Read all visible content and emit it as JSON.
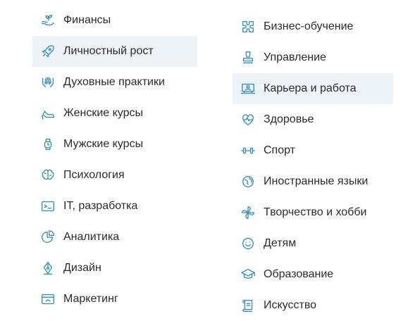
{
  "theme": {
    "icon_color": "#3a8fb7",
    "active_bg": "#eef3f8",
    "text_color": "#2b2b2b"
  },
  "left_column": [
    {
      "label": "Финансы",
      "icon": "hand-plant-icon",
      "active": false
    },
    {
      "label": "Личностный рост",
      "icon": "rocket-icon",
      "active": true
    },
    {
      "label": "Духовные практики",
      "icon": "hands-spiral-icon",
      "active": false
    },
    {
      "label": "Женские курсы",
      "icon": "high-heel-icon",
      "active": false
    },
    {
      "label": "Мужские курсы",
      "icon": "watch-icon",
      "active": false
    },
    {
      "label": "Психология",
      "icon": "brain-icon",
      "active": false
    },
    {
      "label": "IT, разработка",
      "icon": "terminal-icon",
      "active": false
    },
    {
      "label": "Аналитика",
      "icon": "pie-chart-icon",
      "active": false
    },
    {
      "label": "Дизайн",
      "icon": "pen-nib-icon",
      "active": false
    },
    {
      "label": "Маркетинг",
      "icon": "browser-window-icon",
      "active": false
    }
  ],
  "right_column": [
    {
      "label": "Бизнес-обучение",
      "icon": "puzzle-icon",
      "active": false
    },
    {
      "label": "Управление",
      "icon": "stamp-icon",
      "active": false
    },
    {
      "label": "Карьера и работа",
      "icon": "person-desk-icon",
      "active": true
    },
    {
      "label": "Здоровье",
      "icon": "heart-pulse-icon",
      "active": false
    },
    {
      "label": "Спорт",
      "icon": "dumbbell-icon",
      "active": false
    },
    {
      "label": "Иностранные языки",
      "icon": "globe-icon",
      "active": false
    },
    {
      "label": "Творчество и хобби",
      "icon": "pinwheel-icon",
      "active": false
    },
    {
      "label": "Детям",
      "icon": "smiley-icon",
      "active": false
    },
    {
      "label": "Образование",
      "icon": "graduation-cap-icon",
      "active": false
    },
    {
      "label": "Искусство",
      "icon": "scroll-icon",
      "active": false
    }
  ]
}
